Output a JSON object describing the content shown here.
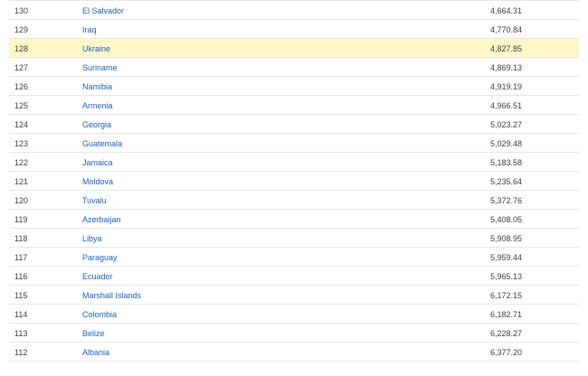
{
  "rows": [
    {
      "rank": "130",
      "country": "El Salvador",
      "value": "4,664.31",
      "highlight": false
    },
    {
      "rank": "129",
      "country": "Iraq",
      "value": "4,770.84",
      "highlight": false
    },
    {
      "rank": "128",
      "country": "Ukraine",
      "value": "4,827.85",
      "highlight": true
    },
    {
      "rank": "127",
      "country": "Suriname",
      "value": "4,869.13",
      "highlight": false
    },
    {
      "rank": "126",
      "country": "Namibia",
      "value": "4,919.19",
      "highlight": false
    },
    {
      "rank": "125",
      "country": "Armenia",
      "value": "4,966.51",
      "highlight": false
    },
    {
      "rank": "124",
      "country": "Georgia",
      "value": "5,023.27",
      "highlight": false
    },
    {
      "rank": "123",
      "country": "Guatemala",
      "value": "5,029.48",
      "highlight": false
    },
    {
      "rank": "122",
      "country": "Jamaica",
      "value": "5,183.58",
      "highlight": false
    },
    {
      "rank": "121",
      "country": "Moldova",
      "value": "5,235.64",
      "highlight": false
    },
    {
      "rank": "120",
      "country": "Tuvalu",
      "value": "5,372.76",
      "highlight": false
    },
    {
      "rank": "119",
      "country": "Azerbaijan",
      "value": "5,408.05",
      "highlight": false
    },
    {
      "rank": "118",
      "country": "Libya",
      "value": "5,908.95",
      "highlight": false
    },
    {
      "rank": "117",
      "country": "Paraguay",
      "value": "5,959.44",
      "highlight": false
    },
    {
      "rank": "116",
      "country": "Ecuador",
      "value": "5,965.13",
      "highlight": false
    },
    {
      "rank": "115",
      "country": "Marshall Islands",
      "value": "6,172.15",
      "highlight": false
    },
    {
      "rank": "114",
      "country": "Colombia",
      "value": "6,182.71",
      "highlight": false
    },
    {
      "rank": "113",
      "country": "Belize",
      "value": "6,228.27",
      "highlight": false
    },
    {
      "rank": "112",
      "country": "Albania",
      "value": "6,377.20",
      "highlight": false
    }
  ],
  "colors": {
    "link": "#1a5fc8",
    "highlight_bg": "#fdf8c6",
    "divider": "#e6e6e6"
  }
}
